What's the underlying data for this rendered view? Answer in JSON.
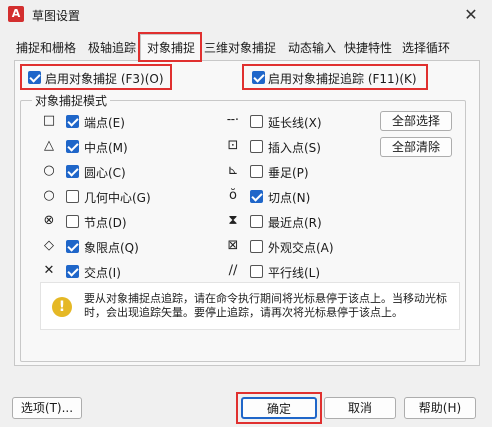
{
  "window": {
    "title": "草图设置",
    "app_icon": "A"
  },
  "tabs": [
    {
      "label": "捕捉和栅格"
    },
    {
      "label": "极轴追踪"
    },
    {
      "label": "对象捕捉"
    },
    {
      "label": "三维对象捕捉"
    },
    {
      "label": "动态输入"
    },
    {
      "label": "快捷特性"
    },
    {
      "label": "选择循环"
    }
  ],
  "top_options": {
    "osnap_on": {
      "label": "启用对象捕捉 (F3)(O)",
      "checked": true
    },
    "osnap_track": {
      "label": "启用对象捕捉追踪 (F11)(K)",
      "checked": true
    }
  },
  "group_title": "对象捕捉模式",
  "modes_left": [
    {
      "icon": "square-icon",
      "label": "端点(E)",
      "checked": true
    },
    {
      "icon": "triangle-icon",
      "label": "中点(M)",
      "checked": true
    },
    {
      "icon": "circle-icon",
      "label": "圆心(C)",
      "checked": true
    },
    {
      "icon": "circle-icon",
      "label": "几何中心(G)",
      "checked": false
    },
    {
      "icon": "circle-x-icon",
      "label": "节点(D)",
      "checked": false
    },
    {
      "icon": "diamond-icon",
      "label": "象限点(Q)",
      "checked": true
    },
    {
      "icon": "x-icon",
      "label": "交点(I)",
      "checked": true
    }
  ],
  "modes_right": [
    {
      "icon": "dash-dot-icon",
      "label": "延长线(X)",
      "checked": false
    },
    {
      "icon": "insert-icon",
      "label": "插入点(S)",
      "checked": false
    },
    {
      "icon": "perpendicular-icon",
      "label": "垂足(P)",
      "checked": false
    },
    {
      "icon": "tangent-icon",
      "label": "切点(N)",
      "checked": true
    },
    {
      "icon": "hourglass-icon",
      "label": "最近点(R)",
      "checked": false
    },
    {
      "icon": "box-x-icon",
      "label": "外观交点(A)",
      "checked": false
    },
    {
      "icon": "parallel-icon",
      "label": "平行线(L)",
      "checked": false
    }
  ],
  "buttons": {
    "select_all": "全部选择",
    "clear_all": "全部清除"
  },
  "hint": "要从对象捕捉点追踪，请在命令执行期间将光标悬停于该点上。当移动光标时，会出现追踪矢量。要停止追踪，请再次将光标悬停于该点上。",
  "footer": {
    "options": "选项(T)...",
    "ok": "确定",
    "cancel": "取消",
    "help": "帮助(H)"
  },
  "colors": {
    "accent": "#1f66c9",
    "highlight": "#e0302f"
  }
}
